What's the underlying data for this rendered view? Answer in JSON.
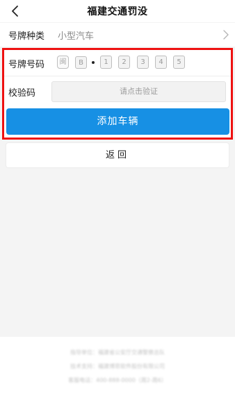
{
  "header": {
    "title": "福建交通罚没",
    "back_icon": "chevron-left-icon"
  },
  "plate_type": {
    "label": "号牌种类",
    "value": "小型汽车",
    "chevron_icon": "chevron-right-icon"
  },
  "plate_number": {
    "label": "号牌号码",
    "province": "闽",
    "letter": "B",
    "digits": [
      "1",
      "2",
      "3",
      "4",
      "5"
    ]
  },
  "verify": {
    "label": "校验码",
    "button_label": "请点击验证"
  },
  "buttons": {
    "add_vehicle": "添加车辆",
    "back": "返回"
  },
  "footer": {
    "line1": "指导单位：福建省公安厅交通警察总队",
    "line2": "技术支持：福建博思软件股份有限公司",
    "line3": "客服电话：400-888-0000（周2-周6）"
  },
  "colors": {
    "accent_blue": "#1790e4",
    "highlight_red": "#ee1111"
  }
}
